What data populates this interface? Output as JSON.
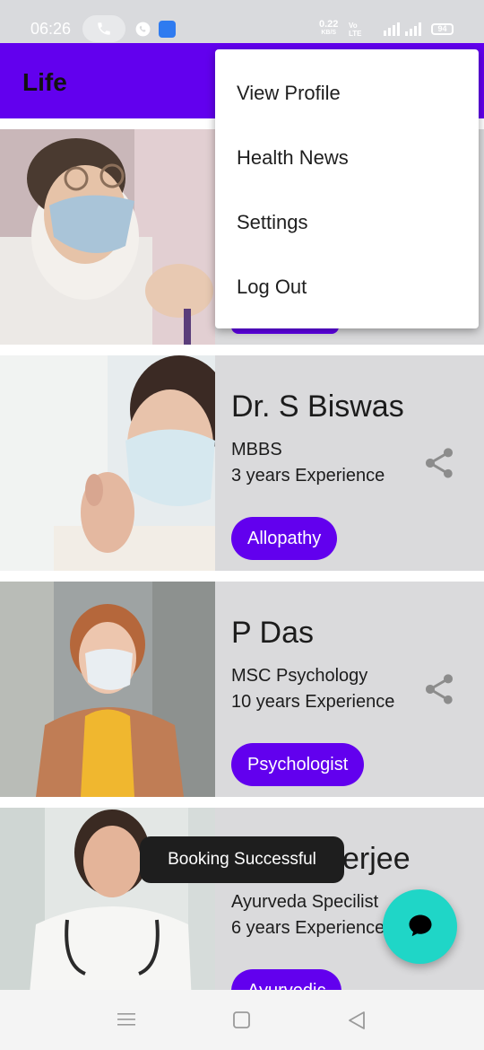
{
  "status_bar": {
    "time": "06:26",
    "net_speed": "0.22",
    "net_unit": "KB/S",
    "volte_top": "Vo",
    "volte_bottom": "LTE",
    "network": "4G",
    "battery": "94"
  },
  "app_bar": {
    "title": "Life"
  },
  "menu": {
    "items": [
      {
        "label": "View Profile"
      },
      {
        "label": "Health News"
      },
      {
        "label": "Settings"
      },
      {
        "label": "Log Out"
      }
    ]
  },
  "doctors": [
    {
      "name": "",
      "degree": "",
      "experience": "",
      "category": ""
    },
    {
      "name": "Dr. S Biswas",
      "degree": "MBBS",
      "experience": "3 years Experience",
      "category": "Allopathy"
    },
    {
      "name": "P Das",
      "degree": "MSC Psychology",
      "experience": "10 years Experience",
      "category": "Psychologist"
    },
    {
      "name": "erjee",
      "degree": "Ayurveda Specilist",
      "experience": "6 years Experience",
      "category": "Ayurvedic"
    }
  ],
  "toast": {
    "message": "Booking Successful"
  },
  "colors": {
    "primary": "#6200ee",
    "fab": "#1fd6c7",
    "card": "#dadadc"
  },
  "icons": {
    "share": "share-icon",
    "chat": "chat-bubble-icon"
  }
}
